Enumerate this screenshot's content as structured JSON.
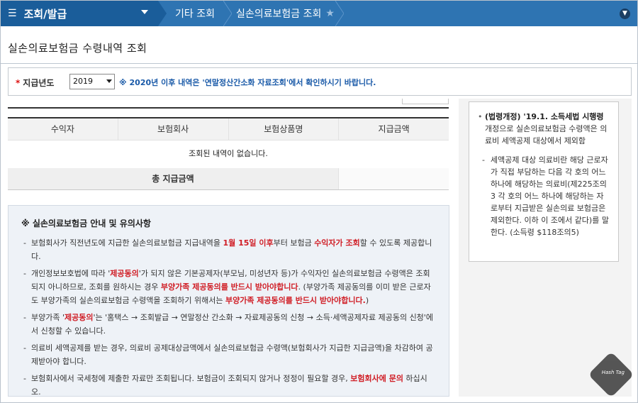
{
  "topbar": {
    "menu_icon": "hamburger-icon",
    "menu_label": "조회/발급",
    "breadcrumb_1": "기타 조회",
    "breadcrumb_2": "실손의료보험금 조회",
    "favorite_icon": "star-icon",
    "expand_icon": "chevron-down-circle-icon",
    "bar_color": "#2e74b2",
    "menu_color": "#1a5d9a"
  },
  "page": {
    "title": "실손의료보험금 수령내역 조회"
  },
  "filter": {
    "required_mark": "*",
    "label": "지급년도",
    "selected_year": "2019",
    "notice": "※ 2020년 이후 내역은 '연말정산간소화 자료조회'에서 확인하시기 바랍니다."
  },
  "table": {
    "headers": [
      "수익자",
      "보험회사",
      "보험상품명",
      "지급금액"
    ],
    "empty_message": "조회된 내역이 없습니다.",
    "total_label": "총 지급금액",
    "total_value": ""
  },
  "info": {
    "title": "※ 실손의료보험금 안내 및 유의사항",
    "items": [
      [
        {
          "t": "보험회사가 직전년도에 지급한 실손의료보험금 지급내역을 "
        },
        {
          "t": "1월 15일 이후",
          "h": true
        },
        {
          "t": "부터 보험금 "
        },
        {
          "t": "수익자가 조회",
          "h": true
        },
        {
          "t": "할 수 있도록 제공합니다."
        }
      ],
      [
        {
          "t": "개인정보보호법에 따라 '"
        },
        {
          "t": "제공동의",
          "h": true
        },
        {
          "t": "'가 되지 않은 기본공제자(부모님, 미성년자 등)가 수익자인 실손의료보험금 수령액은 조회되지 아니하므로, 조회를 원하시는 경우 "
        },
        {
          "t": "부양가족 제공동의를 반드시 받아야합니다",
          "h": true
        },
        {
          "t": ". (부양가족 제공동의를 이미 받은 근로자도 부양가족의 실손의료보험금 수령액을 조회하기 위해서는 "
        },
        {
          "t": "부양가족 제공동의를 반드시 받아야합니다.",
          "h": true
        },
        {
          "t": ")"
        }
      ],
      [
        {
          "t": "부양가족 '"
        },
        {
          "t": "제공동의",
          "h": true
        },
        {
          "t": "'는 '홈택스 → 조회발급 → 연말정산 간소화 → 자료제공동의 신청 → 소득·세액공제자료 제공동의 신청'에서 신청할 수 있습니다."
        }
      ],
      [
        {
          "t": "의료비 세액공제를 받는 경우, 의료비 공제대상금액에서 실손의료보험금 수령액(보험회사가 지급한 지급금액)을 차감하여 공제받아야 합니다."
        }
      ],
      [
        {
          "t": "보험회사에서 국세청에 제출한 자료만 조회됩니다. 보험금이 조회되지 않거나 정정이 필요할 경우, "
        },
        {
          "t": "보험회사에 문의",
          "h": true
        },
        {
          "t": " 하십시오."
        }
      ]
    ],
    "highlight_color": "#d01d25"
  },
  "aside": {
    "note_bold": "(법령개정) '19.1. 소득세법 시행령",
    "note_rest": " 개정으로 실손의료보험금 수령액은 의료비 세액공제 대상에서 제외함",
    "sub_note": "세액공제 대상 의료비란 해당 근로자가 직접 부담하는 다음 각 호의 어느 하나에 해당하는 의료비(제225조의3 각 호의 어느 하나에 해당하는 자로부터 지급받은 실손의료 보험금은 제외한다. 이하 이 조에서 같다)를 말한다. (소득령 $118조의5)"
  },
  "watermark": {
    "text": "Hash Tag"
  }
}
